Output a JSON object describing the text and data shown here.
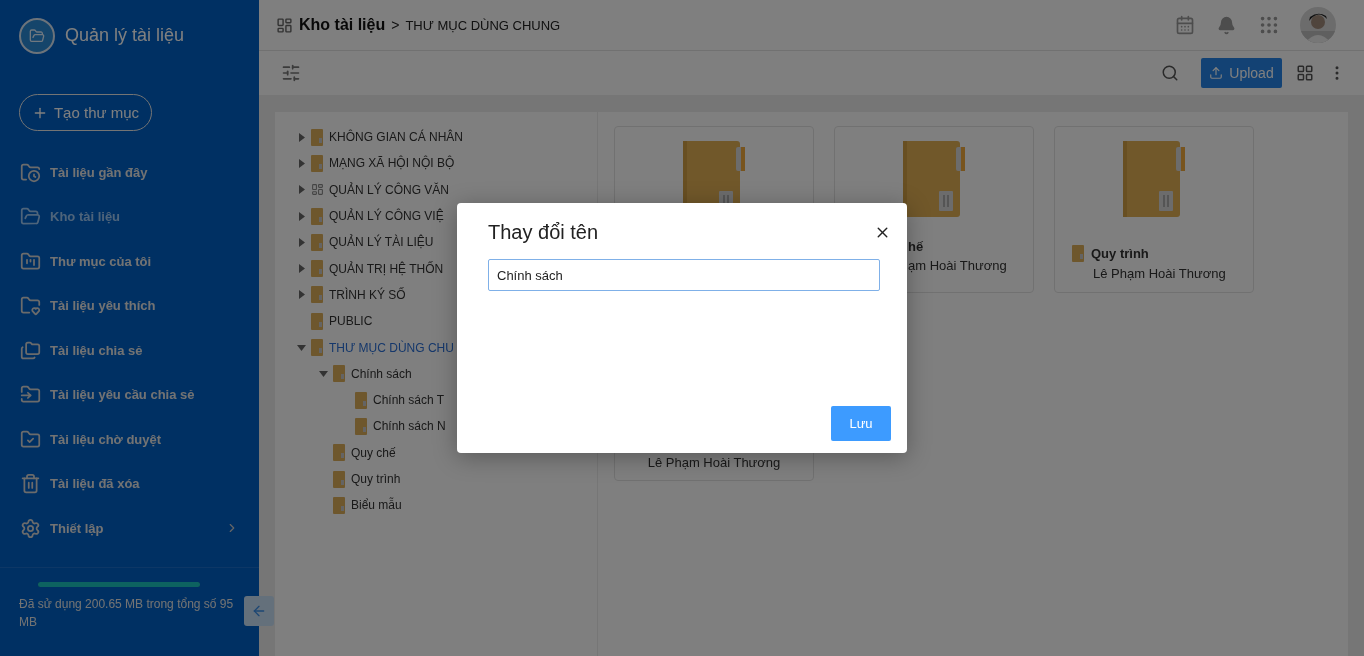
{
  "sidebar": {
    "title": "Quản lý tài liệu",
    "create_button": "Tạo thư mục",
    "items": [
      {
        "kind": "recent",
        "label": "Tài liệu gần đây",
        "selected": false
      },
      {
        "kind": "store",
        "label": "Kho tài liệu",
        "selected": true
      },
      {
        "kind": "mine",
        "label": "Thư mục của tôi",
        "selected": false
      },
      {
        "kind": "favorite",
        "label": "Tài liệu yêu thích",
        "selected": false
      },
      {
        "kind": "shared",
        "label": "Tài liệu chia sẻ",
        "selected": false
      },
      {
        "kind": "request",
        "label": "Tài liệu yêu cầu chia sẻ",
        "selected": false
      },
      {
        "kind": "pending",
        "label": "Tài liệu chờ duyệt",
        "selected": false
      },
      {
        "kind": "trash",
        "label": "Tài liệu đã xóa",
        "selected": false
      },
      {
        "kind": "settings",
        "label": "Thiết lập",
        "selected": false
      }
    ],
    "storage": {
      "level": 1,
      "text": "Đã sử dụng 200.65 MB trong tổng số 95 MB"
    }
  },
  "header": {
    "root": "Kho tài liệu",
    "separator": ">",
    "current": "THƯ MỤC DÙNG CHUNG"
  },
  "toolbar": {
    "upload_button": "Upload"
  },
  "tree": [
    {
      "kind": "folder",
      "label": "KHÔNG GIAN CÁ NHÂN",
      "expanded": false,
      "selected": false
    },
    {
      "kind": "folder",
      "label": "MẠNG XÃ HỘI NỘI BỘ",
      "expanded": false,
      "selected": false
    },
    {
      "kind": "module",
      "label": "QUẢN LÝ CÔNG VĂN",
      "expanded": false,
      "selected": false
    },
    {
      "kind": "folder",
      "label": "QUẢN LÝ CÔNG VIỆ",
      "expanded": false,
      "selected": false
    },
    {
      "kind": "folder",
      "label": "QUẢN LÝ TÀI LIỆU",
      "expanded": false,
      "selected": false
    },
    {
      "kind": "folder",
      "label": "QUẢN TRỊ HỆ THỐN",
      "expanded": false,
      "selected": false
    },
    {
      "kind": "folder",
      "label": "TRÌNH KÝ SỐ",
      "expanded": false,
      "selected": false
    },
    {
      "kind": "folder",
      "label": "PUBLIC",
      "selected": false
    },
    {
      "kind": "folder",
      "label": "THƯ MỤC DÙNG CHU",
      "expanded": true,
      "selected": true,
      "children": [
        {
          "kind": "folder",
          "label": "Chính sách",
          "expanded": true,
          "selected": false,
          "children": [
            {
              "kind": "folder",
              "label": "Chính sách T",
              "selected": false
            },
            {
              "kind": "folder",
              "label": "Chính sách N",
              "selected": false
            }
          ]
        },
        {
          "kind": "folder",
          "label": "Quy chế",
          "selected": false
        },
        {
          "kind": "folder",
          "label": "Quy trình",
          "selected": false
        },
        {
          "kind": "folder",
          "label": "Biểu mẫu",
          "selected": false
        }
      ]
    }
  ],
  "cards": [
    {
      "kind": "hidden"
    },
    {
      "kind": "shifted",
      "name": "hế",
      "owner": "ạm Hoài Thương"
    },
    {
      "kind": "folder",
      "name": "Quy trình",
      "owner": "Lê Phạm Hoài Thương"
    },
    {
      "kind": "centered",
      "owner": "Lê Phạm Hoài Thương"
    }
  ],
  "dialog": {
    "title": "Thay đổi tên",
    "value": "Chính sách",
    "save_button": "Lưu"
  }
}
